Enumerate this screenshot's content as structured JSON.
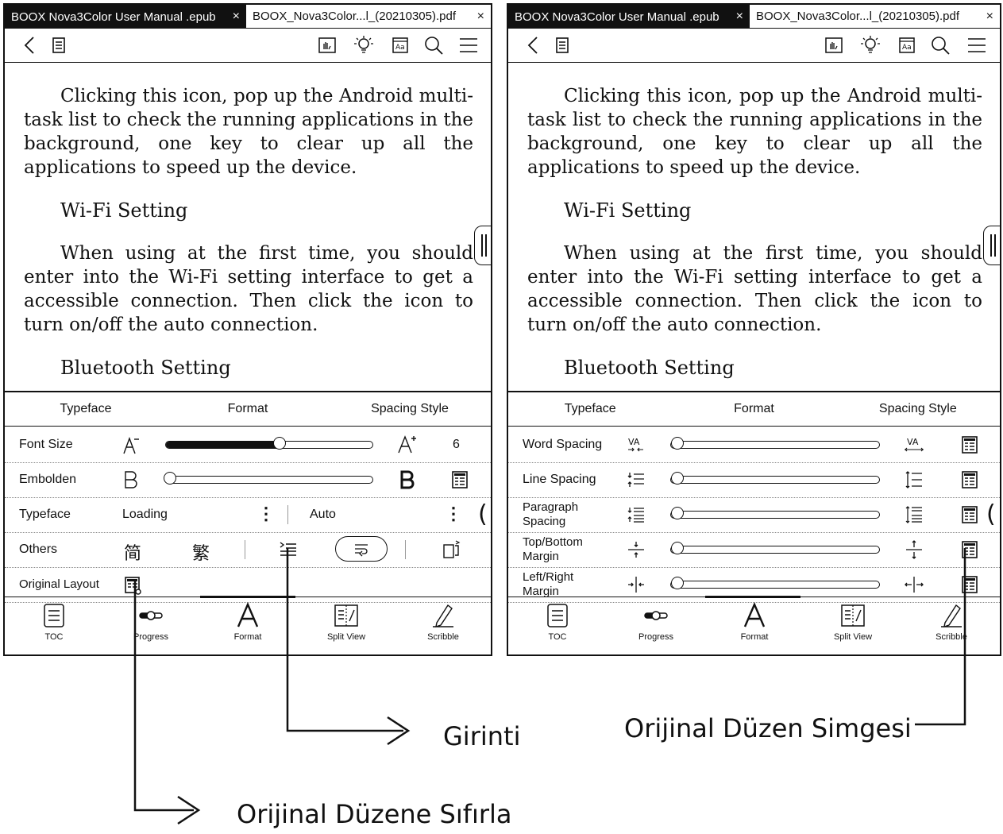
{
  "tabs": {
    "epub_title": "BOOX Nova3Color User Manual .epub",
    "pdf_title": "BOOX_Nova3Color...l_(20210305).pdf",
    "close_glyph": "×"
  },
  "content": {
    "para1": "Clicking this icon, pop up the Android multi-task list to check the running applications in the background, one key to clear up all the applications to speed up the device.",
    "heading_wifi": "Wi-Fi Setting",
    "para2": "When using at the first time, you should enter into the Wi-Fi setting interface to get a accessible connection. Then click the icon to turn on/off the auto connection.",
    "heading_bt": "Bluetooth Setting"
  },
  "settings_tabs": [
    "Typeface",
    "Format",
    "Spacing Style"
  ],
  "left_settings": {
    "font_size_label": "Font Size",
    "font_size_value": "6",
    "font_size_level": 0.55,
    "embolden_label": "Embolden",
    "embolden_level": 0,
    "typeface_label": "Typeface",
    "typeface_value": "Loading",
    "typeface_auto": "Auto",
    "others_label": "Others",
    "simplified_glyph": "简",
    "traditional_glyph": "繁",
    "original_layout_label": "Original Layout"
  },
  "right_settings": {
    "word_spacing": "Word Spacing",
    "line_spacing": "Line Spacing",
    "paragraph_spacing": "Paragraph Spacing",
    "top_bottom_margin": "Top/Bottom Margin",
    "left_right_margin": "Left/Right Margin"
  },
  "nav": [
    "TOC",
    "Progress",
    "Format",
    "Split View",
    "Scribble"
  ],
  "annotations": {
    "indent": "Girinti",
    "original_layout_icon": "Orijinal Düzen Simgesi",
    "reset_original": "Orijinal Düzene Sıfırla"
  }
}
